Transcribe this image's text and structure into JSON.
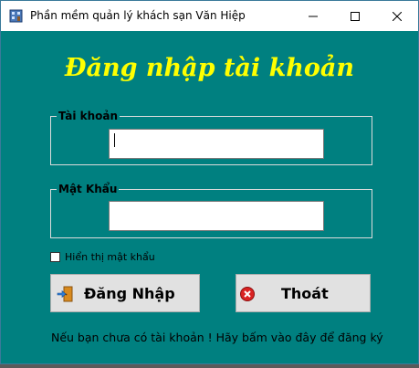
{
  "window": {
    "title": "Phần mềm quản lý khách sạn Văn Hiệp",
    "icon": "app-window-icon",
    "controls": [
      "minimize-icon",
      "maximize-icon",
      "close-icon"
    ]
  },
  "form": {
    "heading": "Đăng nhập tài khoản",
    "username": {
      "label": "Tài khoản",
      "value": ""
    },
    "password": {
      "label": "Mật Khẩu",
      "value": ""
    },
    "show_password": {
      "label": "Hiển thị mật khẩu",
      "checked": false
    },
    "login_button": {
      "label": "Đăng Nhập",
      "icon": "login-door-icon"
    },
    "exit_button": {
      "label": "Thoát",
      "icon": "close-circle-icon"
    },
    "register_text": "Nếu bạn chưa có tài khoản ! Hãy bấm vào đây để đăng ký"
  },
  "colors": {
    "background": "#008080",
    "heading": "#ffff00",
    "button": "#e1e1e1",
    "exit_icon": "#d92323"
  }
}
